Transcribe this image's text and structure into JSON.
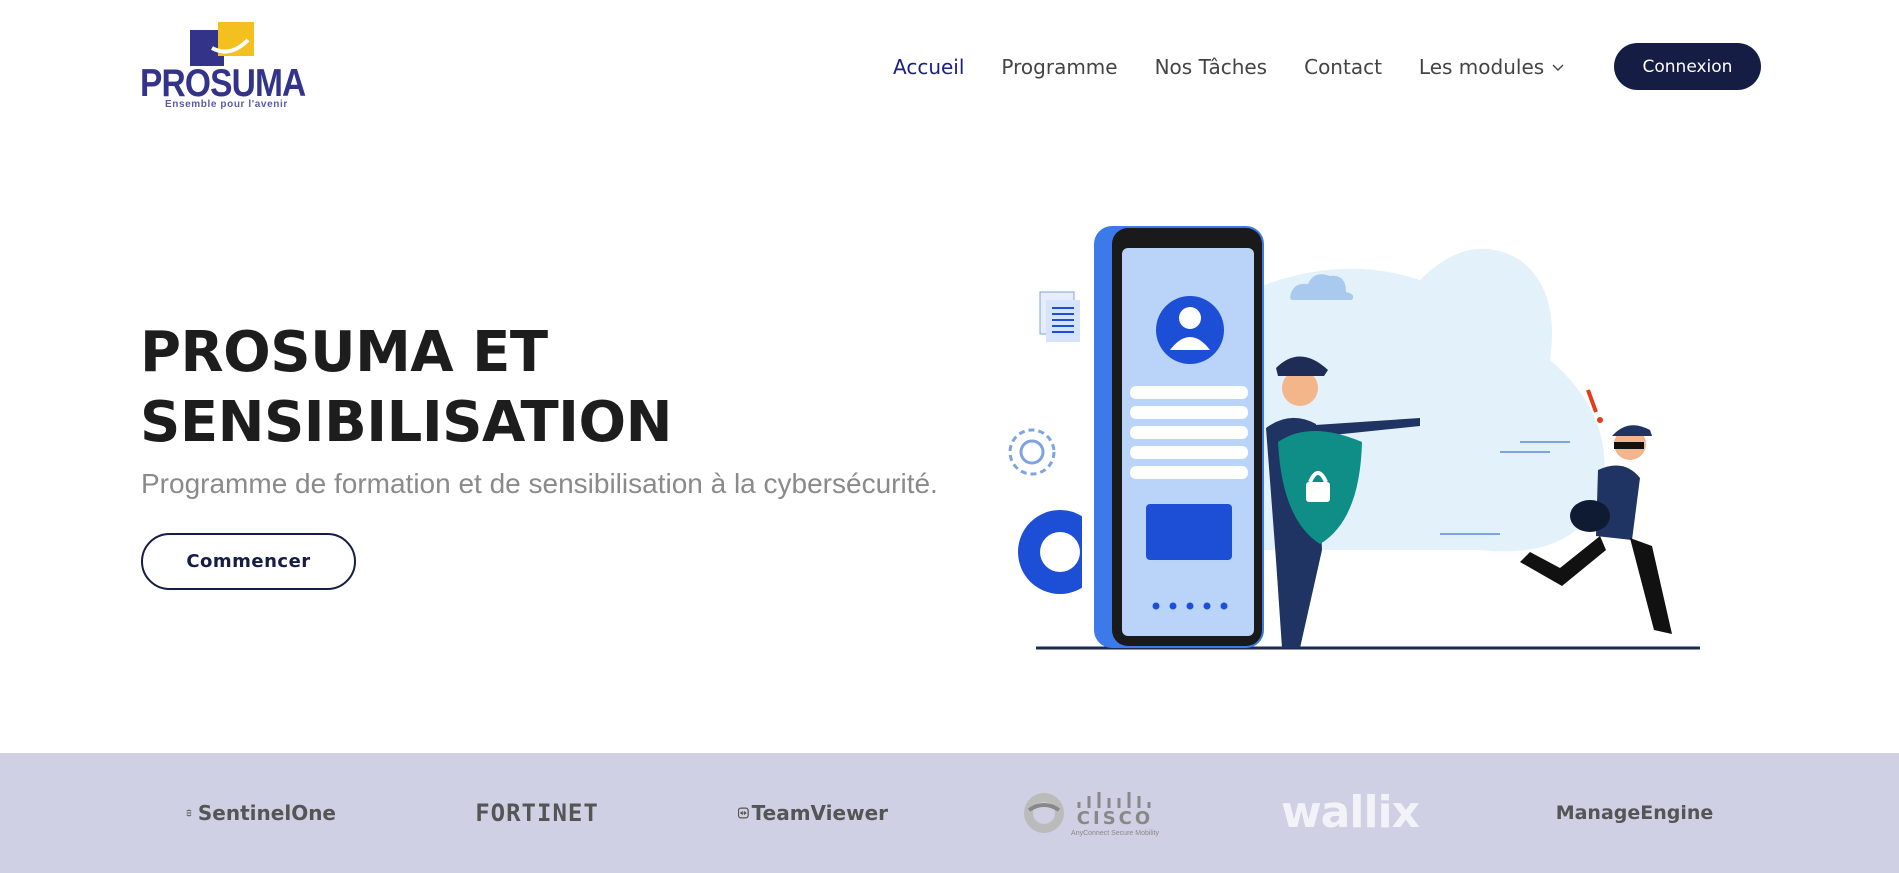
{
  "brand": {
    "name": "PROSUMA",
    "tagline": "Ensemble pour l'avenir",
    "colors": {
      "navy": "#33338a",
      "yellow": "#f4c020"
    }
  },
  "nav": {
    "items": [
      {
        "label": "Accueil",
        "active": true
      },
      {
        "label": "Programme",
        "active": false
      },
      {
        "label": "Nos Tâches",
        "active": false
      },
      {
        "label": "Contact",
        "active": false
      },
      {
        "label": "Les modules",
        "active": false,
        "icon": "chevron-down-icon"
      }
    ],
    "login_label": "Connexion"
  },
  "hero": {
    "title": "PROSUMA ET SENSIBILISATION",
    "subtitle": "Programme de formation et de sensibilisation à la cybersécurité.",
    "cta_label": "Commencer"
  },
  "partners": {
    "items": [
      {
        "name": "SentinelOne",
        "icon": "sentinelone-logo-icon"
      },
      {
        "name": "FORTINET",
        "icon": "fortinet-logo-icon"
      },
      {
        "name": "TeamViewer",
        "icon": "teamviewer-logo-icon"
      },
      {
        "name": "CISCO",
        "caption": "AnyConnect Secure Mobility",
        "icon": "cisco-logo-icon"
      },
      {
        "name": "wallix",
        "icon": "wallix-logo-icon"
      },
      {
        "name": "ManageEngine",
        "icon": "manageengine-logo-icon"
      }
    ],
    "band_color": "#d0d0e4"
  },
  "colors": {
    "accent": "#151d45",
    "nav_active": "#1c2180",
    "subtitle": "#8a8a8a"
  }
}
